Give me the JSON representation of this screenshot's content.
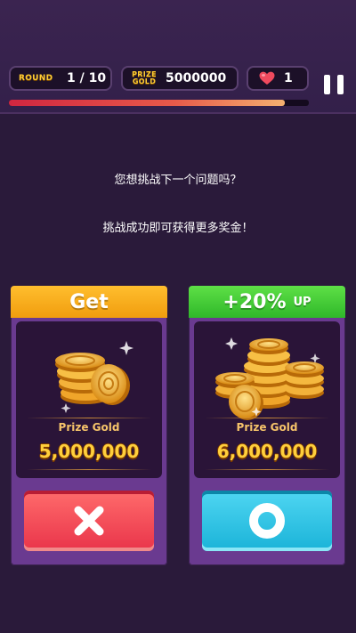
{
  "hud": {
    "round_label": "ROUND",
    "round_value": "1 / 10",
    "gold_label_line1": "PRIZE",
    "gold_label_line2": "GOLD",
    "gold_value": "5000000",
    "lives_value": "1",
    "timer_fraction": 0.92
  },
  "prompt": {
    "line1": "您想挑战下一个问题吗？",
    "line2": "挑战成功即可获得更多奖金！"
  },
  "cards": {
    "left": {
      "header": "Get",
      "prize_label": "Prize Gold",
      "prize_amount": "5,000,000",
      "button_icon": "x-icon"
    },
    "right": {
      "header_main": "+20%",
      "header_suffix": "UP",
      "prize_label": "Prize Gold",
      "prize_amount": "6,000,000",
      "button_icon": "o-icon"
    }
  },
  "colors": {
    "background": "#2a1a3a",
    "card": "#6a3a90",
    "get_header": "#f5a81c",
    "bonus_header": "#3fcc35",
    "decline": "#ef4456",
    "accept": "#2cc3e4",
    "gold_text": "#ffcf3c"
  }
}
